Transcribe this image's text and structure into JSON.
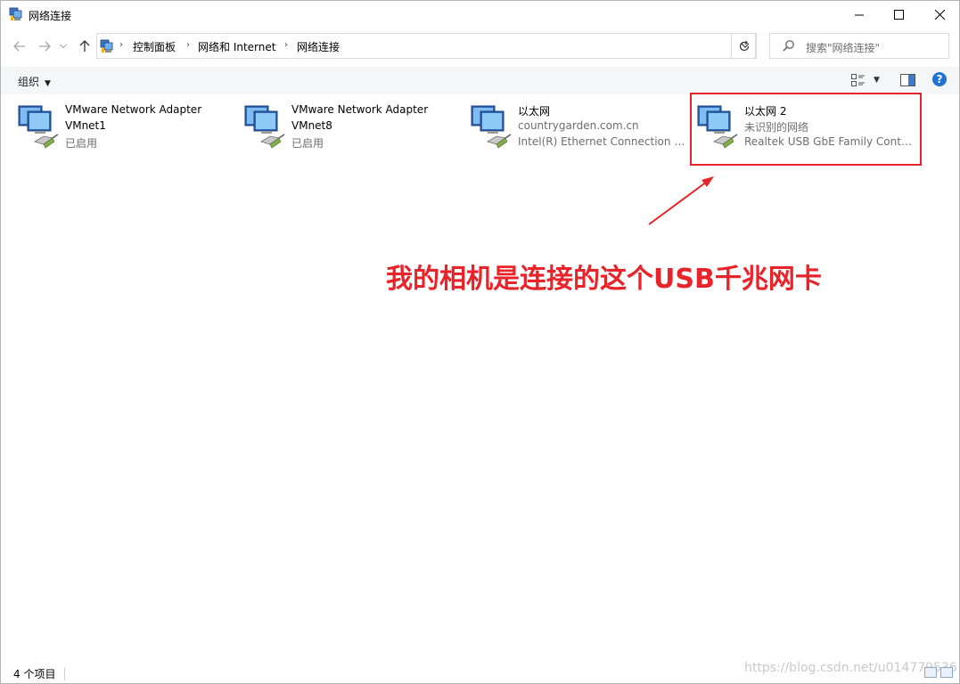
{
  "window": {
    "title": "网络连接",
    "controls": [
      "minimize",
      "maximize",
      "close"
    ]
  },
  "nav": {
    "back_icon": "back-arrow-icon",
    "forward_icon": "forward-arrow-icon",
    "recent_icon": "chevron-down-icon",
    "up_icon": "up-arrow-icon"
  },
  "address": {
    "crumbs": [
      "控制面板",
      "网络和 Internet",
      "网络连接"
    ]
  },
  "search": {
    "placeholder": "搜索\"网络连接\""
  },
  "toolbar": {
    "organize_label": "组织",
    "help_label": "?"
  },
  "adapters": [
    {
      "name": "VMware Network Adapter",
      "line2": "VMnet1",
      "status": "已启用"
    },
    {
      "name": "VMware Network Adapter",
      "line2": "VMnet8",
      "status": "已启用"
    },
    {
      "name": "以太网",
      "line2": "countrygarden.com.cn",
      "status": "Intel(R) Ethernet Connection (7..."
    },
    {
      "name": "以太网 2",
      "line2": "未识别的网络",
      "status": "Realtek USB GbE Family Contr..."
    }
  ],
  "annotation": {
    "text": "我的相机是连接的这个USB千兆网卡",
    "color": "#e8232a"
  },
  "statusbar": {
    "count": "4 个项目",
    "watermark": "https://blog.csdn.net/u014779536"
  }
}
